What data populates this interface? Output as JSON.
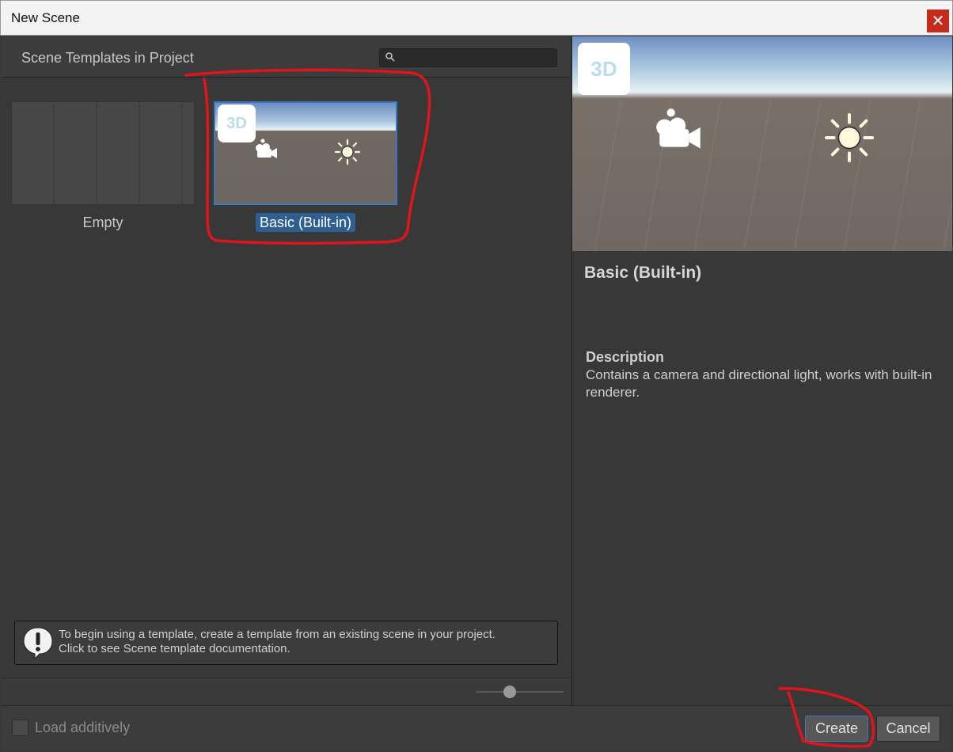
{
  "window": {
    "title": "New Scene",
    "close_glyph": "✕"
  },
  "templates_panel": {
    "header": "Scene Templates in Project",
    "search": {
      "value": "",
      "placeholder": ""
    },
    "items": [
      {
        "label": "Empty",
        "selected": false
      },
      {
        "label": "Basic (Built-in)",
        "selected": true,
        "badge": "3D"
      }
    ],
    "info_message": [
      "To begin using a template, create a template from an existing scene in your project.",
      "Click to see Scene template documentation."
    ],
    "zoom_slider": {
      "value_fraction": 0.38
    }
  },
  "preview_panel": {
    "badge": "3D",
    "title": "Basic (Built-in)",
    "description_heading": "Description",
    "description": "Contains a camera and directional light, works with built-in renderer."
  },
  "footer": {
    "load_additively": {
      "label": "Load additively",
      "checked": false
    },
    "create_label": "Create",
    "cancel_label": "Cancel"
  },
  "colors": {
    "selection": "#2d5f90",
    "accent_border": "#3a79bb",
    "close_button": "#c42b1c",
    "annotation": "#e0141c"
  }
}
